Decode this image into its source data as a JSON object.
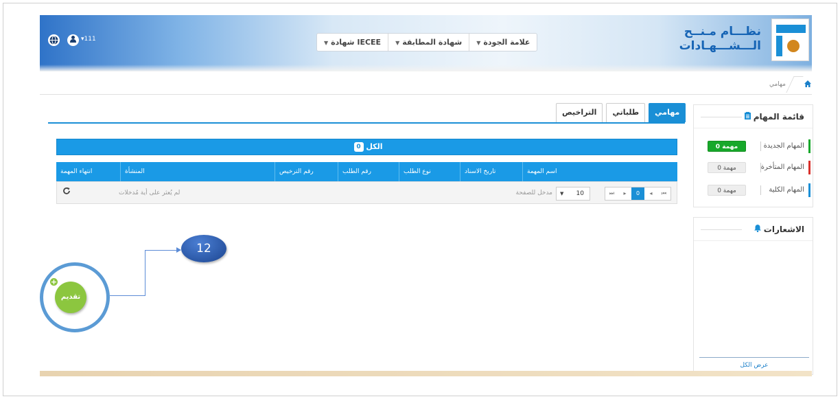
{
  "header": {
    "brand_line1": "نظـــام مـنــح",
    "brand_line2": "الـــشـــهـادات",
    "user_name": "111",
    "nav": [
      {
        "label": "علامة الجودة"
      },
      {
        "label": "شهادة المطابقة"
      },
      {
        "label": "شهادة IECEE"
      }
    ]
  },
  "breadcrumb": {
    "current": "مهامي"
  },
  "tabs": [
    {
      "label": "مهامي",
      "active": true
    },
    {
      "label": "طلباتي",
      "active": false
    },
    {
      "label": "التراخيص",
      "active": false
    }
  ],
  "summary": {
    "label": "الكل",
    "count": "0"
  },
  "table": {
    "columns": [
      "اسم المهمة",
      "تاريخ الاسناد",
      "نوع الطلب",
      "رقم الطلب",
      "رقم الترخيص",
      "المنشأة",
      "انتهاء المهمة"
    ]
  },
  "pager": {
    "current_page": "0",
    "page_size": "10",
    "page_size_label": "مدخل للصفحة",
    "empty_message": "لم يُعثر على أية مُدخلات"
  },
  "tasks_panel": {
    "title": "قائمة المهام",
    "items": [
      {
        "label": "المهام الجديدة",
        "badge": "0 مهمة",
        "color": "#17a82b"
      },
      {
        "label": "المهام المتأخرة",
        "badge": "0 مهمة",
        "color": "#d9302b"
      },
      {
        "label": "المهام الكلية",
        "badge": "0 مهمة",
        "color": "#1a8fd6"
      }
    ]
  },
  "notifications_panel": {
    "title": "الاشعارات",
    "view_all": "عرض الكل"
  },
  "annotation": {
    "number": "12"
  },
  "submit_button": {
    "label": "تقديم"
  },
  "icons": [
    "globe-icon",
    "user-icon",
    "home-icon",
    "clipboard-icon",
    "bell-icon",
    "refresh-icon",
    "plus-icon"
  ]
}
